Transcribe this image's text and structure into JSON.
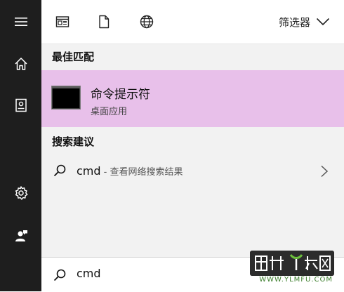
{
  "rail": {
    "icons": [
      "menu-icon",
      "home-icon",
      "notebook-icon",
      "gear-icon",
      "user-feedback-icon"
    ],
    "background": "#1e1e1e"
  },
  "toolbar": {
    "icons": [
      "apps-icon",
      "document-icon",
      "web-globe-icon"
    ],
    "filter_label": "筛选器"
  },
  "sections": {
    "best_match_title": "最佳匹配",
    "suggestions_title": "搜索建议"
  },
  "best_match": {
    "title": "命令提示符",
    "subtitle": "桌面应用",
    "highlight_color": "#e8c0ea"
  },
  "suggestion": {
    "query": "cmd",
    "note": " - 查看网络搜索结果"
  },
  "search": {
    "value": "cmd"
  },
  "watermark": {
    "url": "WWW.YLMFU.COM"
  }
}
